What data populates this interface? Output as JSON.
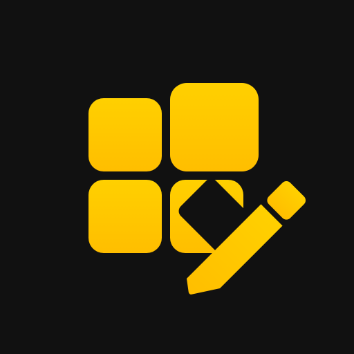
{
  "app_icon": {
    "name": "widget-grid-edit-icon",
    "colors": {
      "background": "#111111",
      "accent_top": "#FFD000",
      "accent_bottom": "#FFBE00"
    }
  }
}
